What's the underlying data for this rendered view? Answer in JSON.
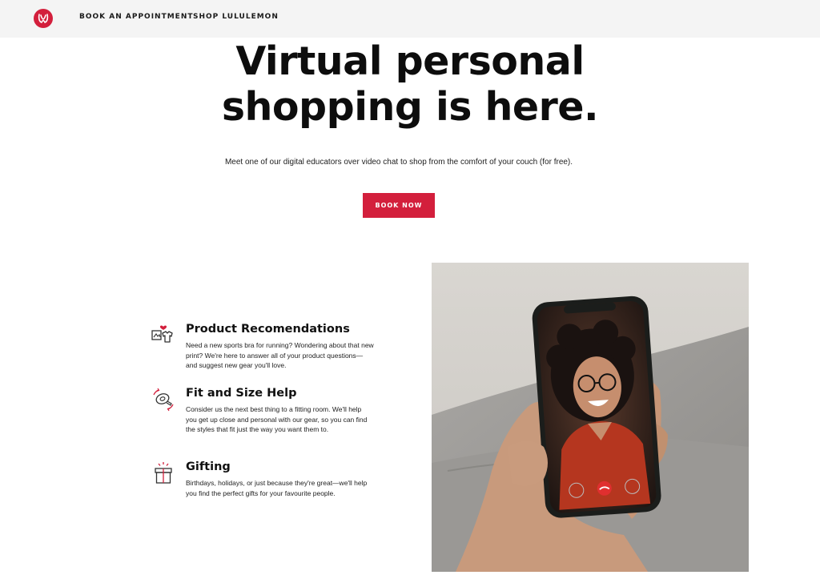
{
  "nav": {
    "logo_icon": "lululemon-logo-icon",
    "book_label": "BOOK AN APPOINTMENT",
    "shop_label": "SHOP LULULEMON"
  },
  "hero": {
    "title_line1": "Virtual personal",
    "title_line2": "shopping is here.",
    "subtitle": "Meet one of our digital educators over video chat to shop from the comfort of your couch (for free).",
    "cta_label": "BOOK NOW"
  },
  "features": [
    {
      "icon": "clothing-heart-icon",
      "title": "Product Recomendations",
      "description": "Need a new sports bra for running? Wondering about that new print? We're here to answer all of your product questions—and suggest new gear you'll love."
    },
    {
      "icon": "measuring-tape-icon",
      "title": "Fit and Size Help",
      "description": "Consider us the next best thing to a fitting room. We'll help you get up close and personal with our gear, so you can find the styles that fit just the way you want them to."
    },
    {
      "icon": "gift-icon",
      "title": "Gifting",
      "description": "Birthdays, holidays, or just because they're great—we'll help you find the perfect gifts for your favourite people."
    }
  ],
  "colors": {
    "brand_red": "#d31f3c",
    "topbar_bg": "#f4f4f4"
  }
}
